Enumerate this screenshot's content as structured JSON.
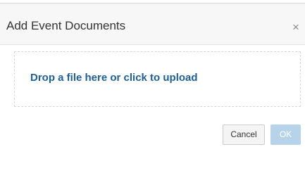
{
  "dialog": {
    "title": "Add Event Documents",
    "close_symbol": "×",
    "close_icon": "close-icon",
    "dropzone": {
      "text": "Drop a file here or click to upload"
    },
    "buttons": {
      "cancel_label": "Cancel",
      "ok_label": "OK",
      "ok_disabled": true
    },
    "colors": {
      "header_bg": "#f7f7f7",
      "link_text": "#1f5f96",
      "ok_disabled_bg": "#b7d3ea"
    }
  }
}
